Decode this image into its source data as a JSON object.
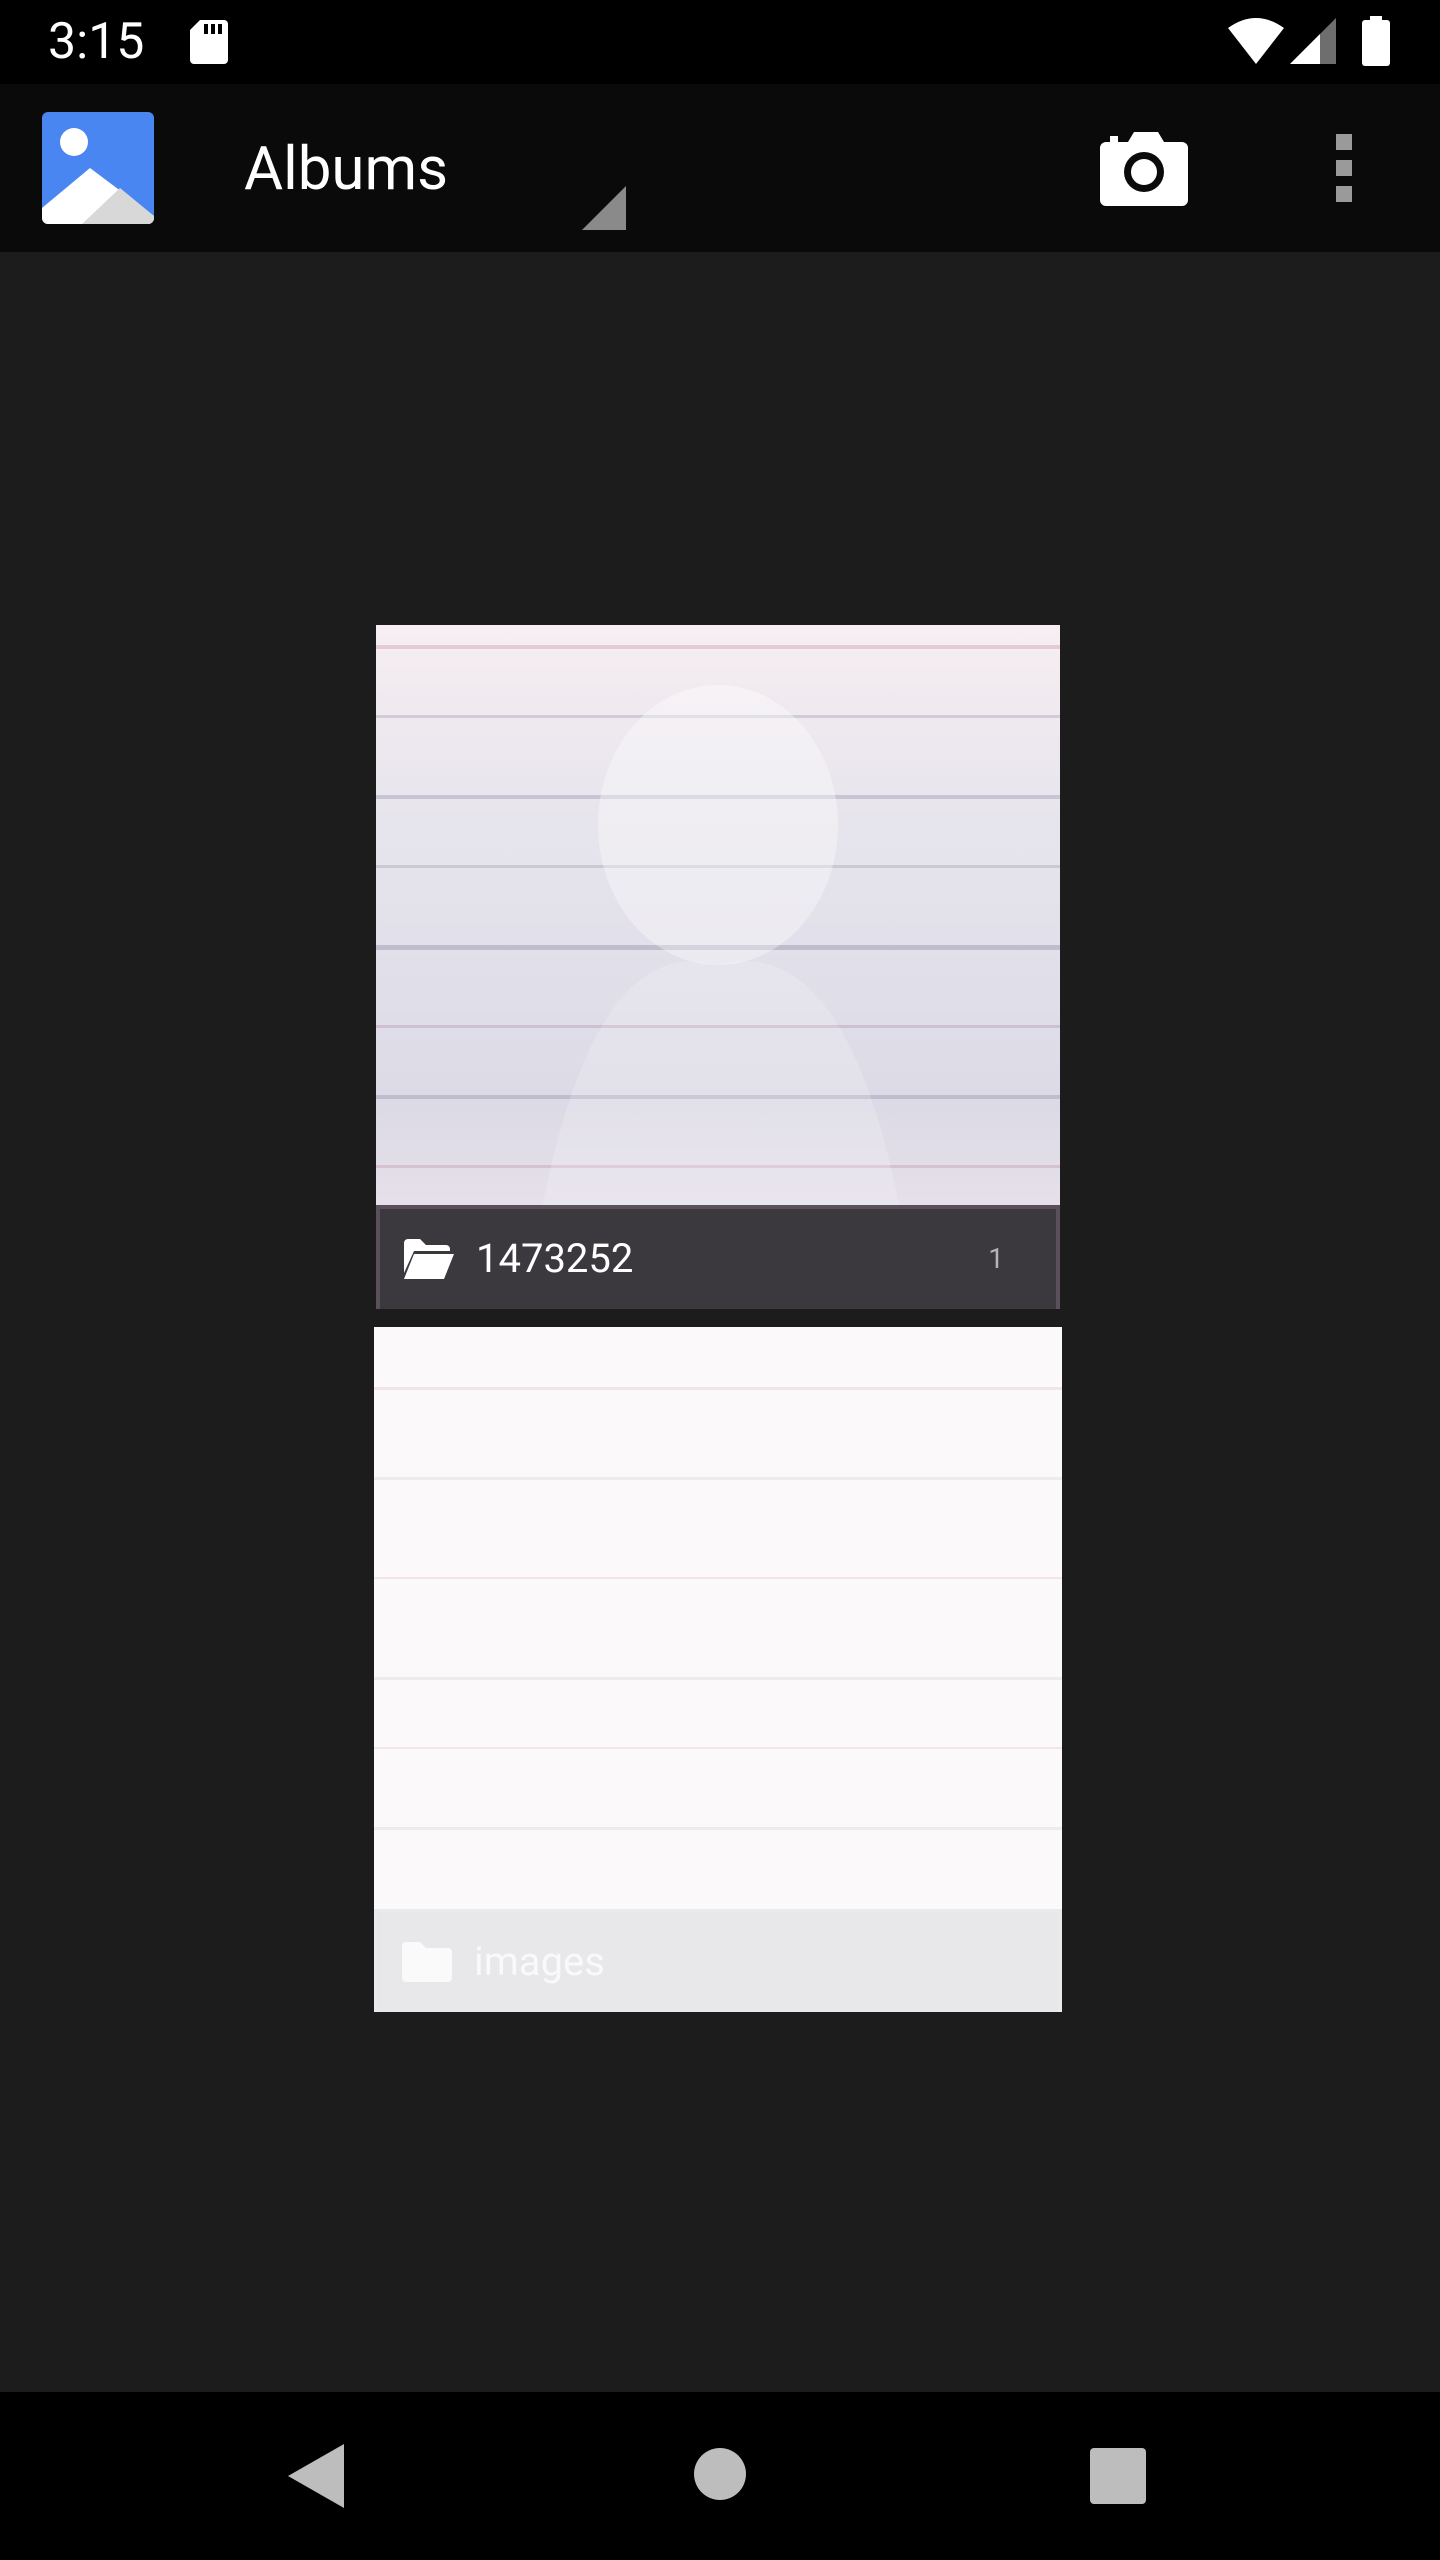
{
  "status_bar": {
    "time": "3:15",
    "icons": [
      "sd-card-icon",
      "wifi-icon",
      "cell-signal-icon",
      "battery-icon"
    ]
  },
  "toolbar": {
    "title": "Albums",
    "icons": {
      "app_logo": "gallery-app-icon",
      "dropdown": "dropdown-triangle-icon",
      "camera": "camera-icon",
      "overflow": "overflow-menu-icon"
    }
  },
  "albums": [
    {
      "name": "1473252",
      "count": "1",
      "icon": "folder-open-icon"
    },
    {
      "name": "images",
      "count": "",
      "icon": "folder-icon"
    }
  ],
  "nav_bar": {
    "icons": [
      "back-icon",
      "home-icon",
      "recents-icon"
    ]
  },
  "colors": {
    "background": "#1c1c1c",
    "toolbar": "#0a0a0a",
    "status_bar": "#000000",
    "label_bar": "#3a383c",
    "app_logo_blue": "#4a86f2"
  }
}
